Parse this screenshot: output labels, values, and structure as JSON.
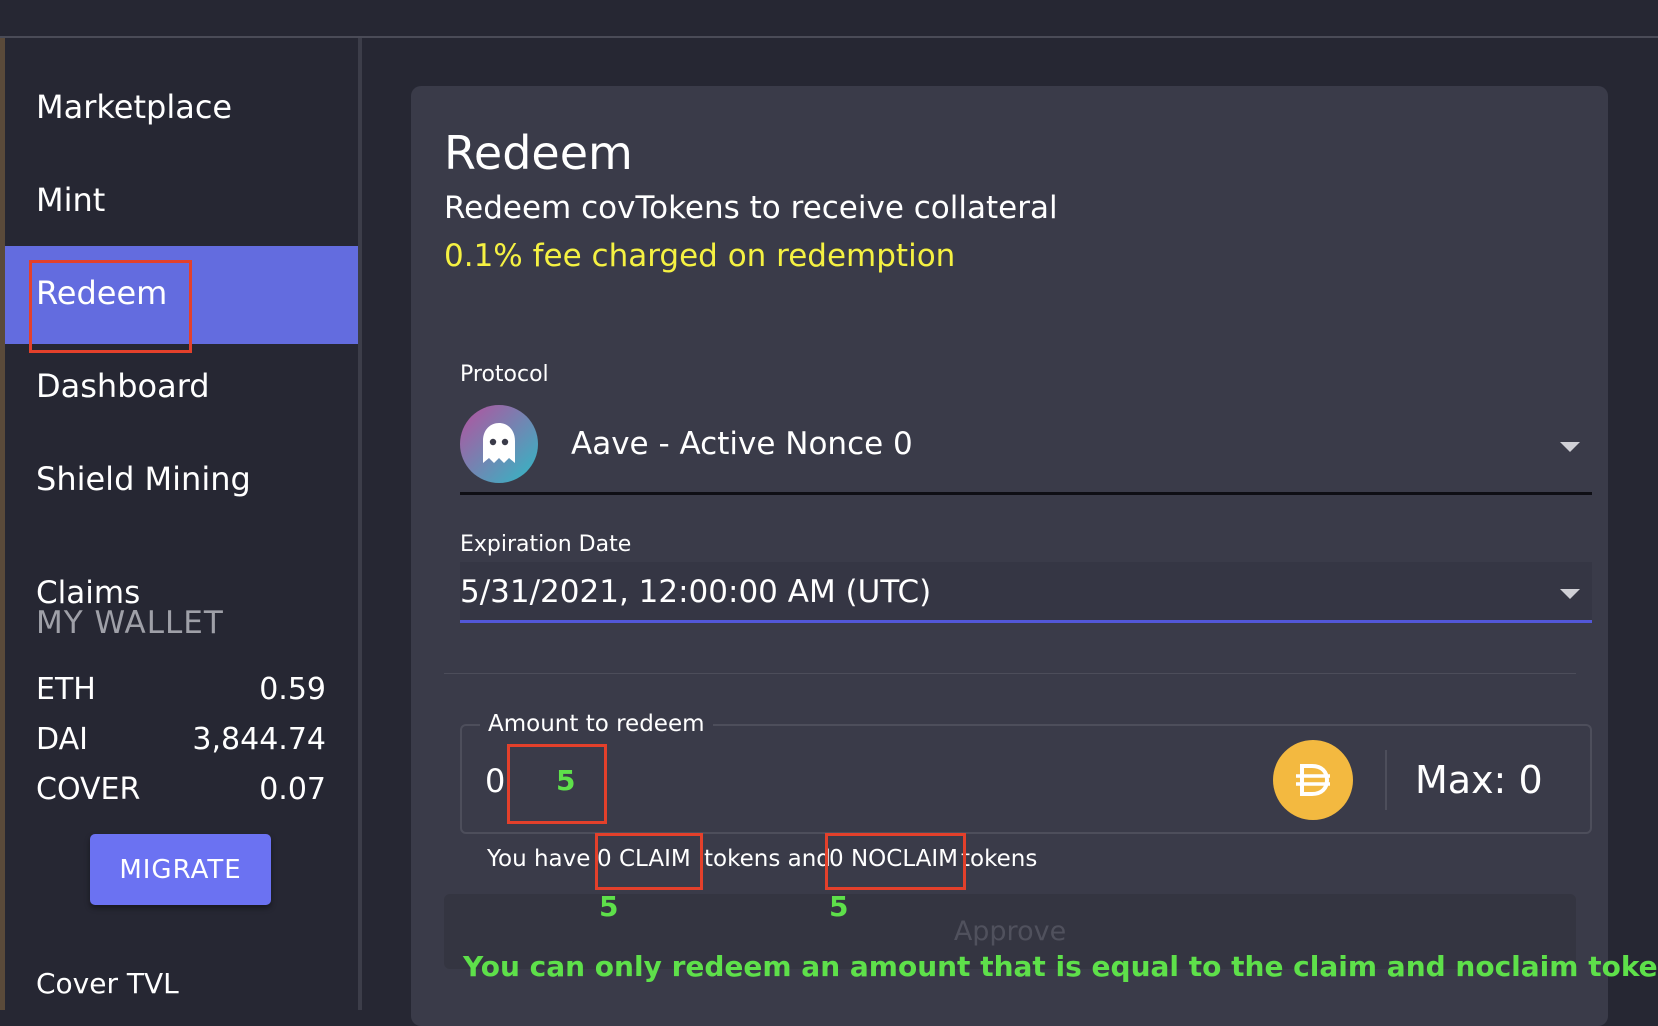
{
  "sidebar": {
    "items": [
      {
        "label": "Marketplace"
      },
      {
        "label": "Mint"
      },
      {
        "label": "Redeem"
      },
      {
        "label": "Dashboard"
      },
      {
        "label": "Shield Mining"
      },
      {
        "label": "Claims"
      }
    ],
    "active_item": "Redeem",
    "wallet_title": "MY WALLET",
    "wallet": [
      {
        "symbol": "ETH",
        "value": "0.59"
      },
      {
        "symbol": "DAI",
        "value": "3,844.74"
      },
      {
        "symbol": "COVER",
        "value": "0.07"
      }
    ],
    "migrate_label": "MIGRATE",
    "cover_tvl_label": "Cover TVL"
  },
  "main": {
    "title": "Redeem",
    "subtitle": "Redeem covTokens to receive collateral",
    "fee_notice": "0.1% fee charged on redemption",
    "protocol": {
      "label": "Protocol",
      "value": "Aave - Active Nonce 0",
      "icon": "aave-ghost-icon"
    },
    "expiration": {
      "label": "Expiration Date",
      "value": "5/31/2021, 12:00:00 AM (UTC)"
    },
    "amount": {
      "label": "Amount to redeem",
      "value": "0",
      "annotation": "5",
      "token_icon": "dai-icon",
      "max_label": "Max: 0"
    },
    "balance": {
      "prefix": "You have",
      "claim": "0 CLAIM",
      "middle": "tokens and",
      "noclaim": "0 NOCLAIM",
      "suffix": "tokens",
      "claim_annotation": "5",
      "noclaim_annotation": "5"
    },
    "approve_label": "Approve",
    "annotation_note": "You can only redeem an amount that is equal to the claim and noclaim tokens"
  },
  "colors": {
    "background": "#262733",
    "card": "#3a3b49",
    "active_nav": "#636cdf",
    "fee_yellow": "#f5f142",
    "annotation_green": "#5ee04a",
    "highlight_red": "#e3402b",
    "migrate_button": "#6b72f2"
  }
}
